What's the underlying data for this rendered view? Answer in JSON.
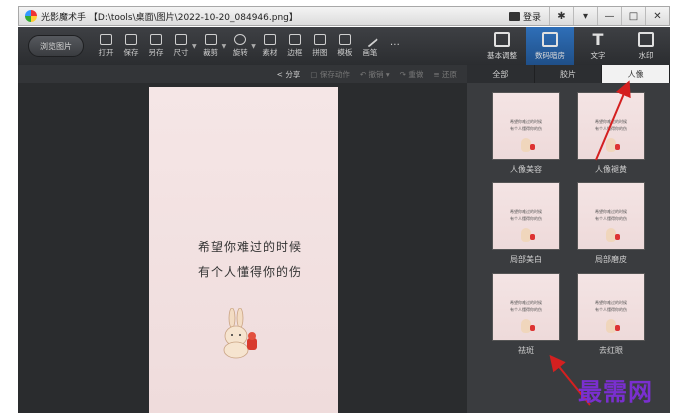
{
  "window": {
    "app_name": "光影魔术手",
    "file_path": "【D:\\tools\\桌面\\图片\\2022-10-20_084946.png】",
    "login_label": "登录",
    "controls": [
      "✱",
      "▾",
      "—",
      "□",
      "✕"
    ]
  },
  "toolbar": {
    "browse_label": "浏览图片",
    "tools": [
      {
        "label": "打开",
        "icon": "open-icon"
      },
      {
        "label": "保存",
        "icon": "save-icon"
      },
      {
        "label": "另存",
        "icon": "save-as-icon"
      },
      {
        "label": "尺寸",
        "icon": "resize-icon"
      },
      {
        "label": "裁剪",
        "icon": "crop-icon"
      },
      {
        "label": "旋转",
        "icon": "rotate-icon"
      },
      {
        "label": "素材",
        "icon": "material-icon"
      },
      {
        "label": "边框",
        "icon": "border-icon"
      },
      {
        "label": "拼图",
        "icon": "collage-icon"
      },
      {
        "label": "模板",
        "icon": "template-icon"
      },
      {
        "label": "画笔",
        "icon": "brush-icon"
      },
      {
        "label": "…",
        "icon": "more-icon"
      }
    ],
    "right_tools": [
      {
        "label": "基本调整",
        "icon": "adjust-icon"
      },
      {
        "label": "数码暗房",
        "icon": "darkroom-icon"
      },
      {
        "label": "文字",
        "icon": "text-icon",
        "glyph": "T"
      },
      {
        "label": "水印",
        "icon": "watermark-icon"
      }
    ]
  },
  "subbar": {
    "share": "分享",
    "save_action": "保存动作",
    "undo": "撤销",
    "redo": "重做",
    "restore": "还原"
  },
  "photo": {
    "line1": "希望你难过的时候",
    "line2": "有个人懂得你的伤"
  },
  "panel": {
    "tabs": [
      "全部",
      "胶片",
      "人像"
    ],
    "active_tab": "人像",
    "effects": [
      {
        "label": "人像美容"
      },
      {
        "label": "人像褪黄"
      },
      {
        "label": "局部美白"
      },
      {
        "label": "局部磨皮"
      },
      {
        "label": "祛斑"
      },
      {
        "label": "去红眼"
      }
    ],
    "thumb_line1": "希望你难过的时候",
    "thumb_line2": "有个人懂得你的伤"
  },
  "watermark_text": "最需网",
  "colors": {
    "annotation_arrow": "#d42020",
    "active_tool": "#2f6fb8",
    "watermark": "#7a2fd0"
  }
}
